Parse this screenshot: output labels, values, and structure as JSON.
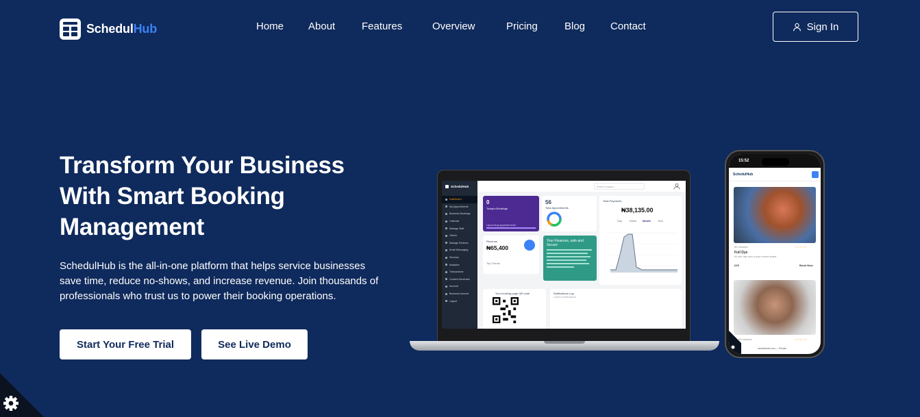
{
  "brand": {
    "name_part1": "Schedul",
    "name_part2": "Hub",
    "logo_icon": "calendar-logo-icon"
  },
  "nav": {
    "items": [
      "Home",
      "About",
      "Features",
      "Overview",
      "Pricing",
      "Blog",
      "Contact"
    ]
  },
  "header": {
    "signin_label": "Sign In",
    "signin_icon": "user-icon"
  },
  "hero": {
    "title": "Transform Your Business With Smart Booking Management",
    "description": "SchedulHub is the all-in-one platform that helps service businesses save time, reduce no-shows, and increase revenue. Join thousands of professionals who trust us to power their booking operations.",
    "cta_primary": "Start Your Free Trial",
    "cta_secondary": "See Live Demo"
  },
  "cookie_settings": {
    "icon": "gear-icon"
  },
  "laptop_mockup": {
    "sidebar_logo": "SchedulHub",
    "search_placeholder": "Search pages...",
    "sidebar_items": [
      "Dashboard",
      "My Appointments",
      "Business Bookings",
      "Calendar",
      "Manage Staff",
      "Clients",
      "Manage Reviews",
      "Email Messaging",
      "Services",
      "Analytics",
      "Transactions",
      "Content Generator",
      "Account",
      "Business Account",
      "Logout"
    ],
    "todays_bookings_value": "0",
    "todays_bookings_label": "Today's Bookings",
    "upcoming_label": "Upcoming appointments",
    "total_appointments_value": "56",
    "total_appointments_label": "Total Appointments",
    "total_payments_label": "Total Payments",
    "total_payments_value": "₦38,135.00",
    "period_tabs": [
      "Day",
      "Week",
      "Month",
      "Year"
    ],
    "revenue_label": "Revenue",
    "revenue_value": "₦65,400",
    "top_clients_label": "Top Clients",
    "secure_title": "Your Finances, safe and Secure",
    "qr_label": "Your booking page QR code",
    "notifications_label": "Notifications Log",
    "notifications_sub": "Latest notifications"
  },
  "phone_mockup": {
    "time": "15:52",
    "logo": "SchedulHub",
    "item1_duration": "60 minutes",
    "item1_name": "Full Dye",
    "item1_desc": "All over hair color in your chosen shade.",
    "item1_price": "£25",
    "item1_action": "Book Now",
    "item2_duration": "60 minutes",
    "url": "schedulhub.com — Private"
  },
  "colors": {
    "background": "#0f2a5c",
    "accent": "#3b82f6",
    "button_bg": "#ffffff",
    "button_text": "#0f2a5c"
  }
}
